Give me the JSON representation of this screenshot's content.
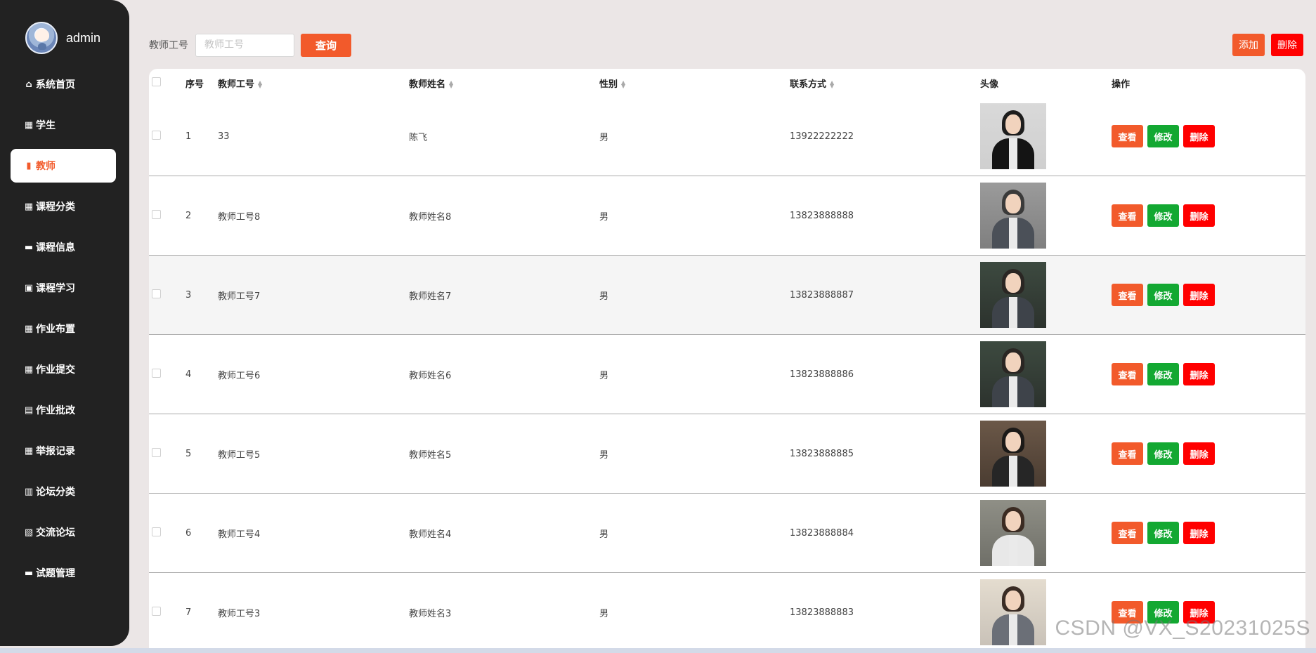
{
  "user": {
    "name": "admin"
  },
  "sidebar": {
    "items": [
      {
        "label": "系统首页",
        "icon": "home-icon",
        "glyph": "⌂",
        "active": false
      },
      {
        "label": "学生",
        "icon": "grid-icon",
        "glyph": "▦",
        "active": false
      },
      {
        "label": "教师",
        "icon": "book-icon",
        "glyph": "▮",
        "active": true
      },
      {
        "label": "课程分类",
        "icon": "grid-icon",
        "glyph": "▦",
        "active": false
      },
      {
        "label": "课程信息",
        "icon": "comment-icon",
        "glyph": "▬",
        "active": false
      },
      {
        "label": "课程学习",
        "icon": "briefcase-icon",
        "glyph": "▣",
        "active": false
      },
      {
        "label": "作业布置",
        "icon": "grid-icon",
        "glyph": "▦",
        "active": false
      },
      {
        "label": "作业提交",
        "icon": "grid-icon",
        "glyph": "▦",
        "active": false
      },
      {
        "label": "作业批改",
        "icon": "clipboard-icon",
        "glyph": "▤",
        "active": false
      },
      {
        "label": "举报记录",
        "icon": "apps-icon",
        "glyph": "▦",
        "active": false
      },
      {
        "label": "论坛分类",
        "icon": "bar-chart-icon",
        "glyph": "▥",
        "active": false
      },
      {
        "label": "交流论坛",
        "icon": "trash-icon",
        "glyph": "▧",
        "active": false
      },
      {
        "label": "试题管理",
        "icon": "monitor-icon",
        "glyph": "▬",
        "active": false
      }
    ]
  },
  "search": {
    "label": "教师工号",
    "placeholder": "教师工号",
    "value": "",
    "button": "查询"
  },
  "actions": {
    "add": "添加",
    "delete": "删除"
  },
  "table": {
    "headers": {
      "index": "序号",
      "teacher_no": "教师工号",
      "teacher_name": "教师姓名",
      "gender": "性别",
      "phone": "联系方式",
      "photo": "头像",
      "ops": "操作"
    },
    "op_labels": {
      "view": "查看",
      "edit": "修改",
      "delete": "删除"
    },
    "rows": [
      {
        "index": "1",
        "teacher_no": "33",
        "teacher_name": "陈飞",
        "gender": "男",
        "phone": "13922222222"
      },
      {
        "index": "2",
        "teacher_no": "教师工号8",
        "teacher_name": "教师姓名8",
        "gender": "男",
        "phone": "13823888888"
      },
      {
        "index": "3",
        "teacher_no": "教师工号7",
        "teacher_name": "教师姓名7",
        "gender": "男",
        "phone": "13823888887"
      },
      {
        "index": "4",
        "teacher_no": "教师工号6",
        "teacher_name": "教师姓名6",
        "gender": "男",
        "phone": "13823888886"
      },
      {
        "index": "5",
        "teacher_no": "教师工号5",
        "teacher_name": "教师姓名5",
        "gender": "男",
        "phone": "13823888885"
      },
      {
        "index": "6",
        "teacher_no": "教师工号4",
        "teacher_name": "教师姓名4",
        "gender": "男",
        "phone": "13823888884"
      },
      {
        "index": "7",
        "teacher_no": "教师工号3",
        "teacher_name": "教师姓名3",
        "gender": "男",
        "phone": "13823888883"
      }
    ]
  },
  "watermark": "CSDN @VX_S20231025S",
  "colors": {
    "sidebar": "#222222",
    "accent": "#f25a2b",
    "success": "#13a832",
    "danger": "#ff0000",
    "page_bg": "#ebe6e6"
  }
}
